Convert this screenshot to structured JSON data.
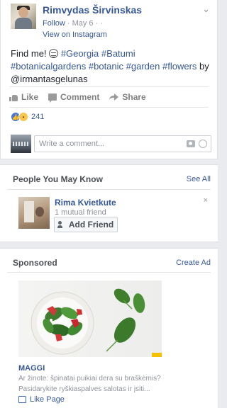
{
  "post": {
    "author": "Rimvydas Širvinskas",
    "follow_label": "Follow",
    "meta_separator": " · ",
    "date": "May 6",
    "meta_globe": "·",
    "view_on_instagram": "View on Instagram",
    "chevron": "⌄",
    "text_prefix": "Find me! ",
    "hashtags": [
      "#Georgia",
      "#Batumi",
      "#botanicalgardens",
      "#botanic",
      "#garden",
      "#flowers"
    ],
    "text_by": "by",
    "mention": "@irmantasgelunas",
    "actions": {
      "like": "Like",
      "comment": "Comment",
      "share": "Share"
    },
    "reaction_count": "241",
    "comment_placeholder": "Write a comment..."
  },
  "pymk": {
    "title": "People You May Know",
    "see_all": "See All",
    "person": {
      "name": "Rima Kvietkute",
      "mutual": "1 mutual friend"
    },
    "add_friend_label": "Add Friend",
    "dismiss": "×"
  },
  "sponsored": {
    "title": "Sponsored",
    "create_ad": "Create Ad",
    "brand": "MAGGI",
    "text_line1": "Ar žinote: špinatai puikiai dera su braškėmis?",
    "text_line2": "Pasidarykite ryškiaspalves salotas ir įsiti...",
    "like_page": "Like Page"
  },
  "colors": {
    "link": "#365899",
    "muted": "#90949c",
    "background": "#e9ebee",
    "like_reaction": "#4a76d8",
    "wow_reaction": "#f7c64b",
    "maggi_yellow": "#f2c200"
  },
  "icons": [
    "chevron-down-icon",
    "globe-icon",
    "like-icon",
    "comment-icon",
    "share-icon",
    "like-reaction-icon",
    "wow-reaction-icon",
    "camera-icon",
    "smiley-icon",
    "add-friend-icon",
    "close-icon",
    "thumbs-up-icon"
  ]
}
